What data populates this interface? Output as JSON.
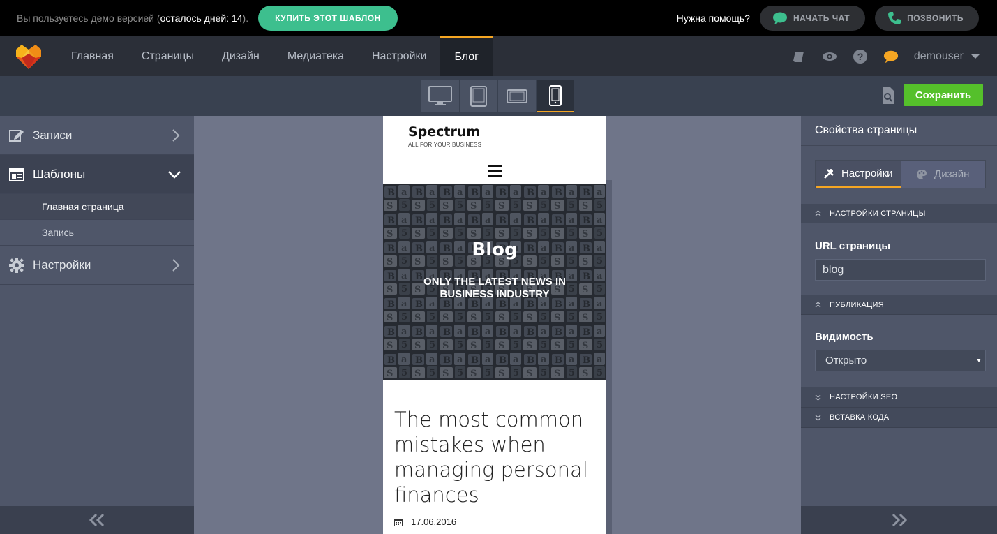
{
  "topbar": {
    "demo_prefix": "Вы пользуетесь демо версией (",
    "demo_days": "осталось дней: 14",
    "demo_suffix": ").",
    "buy_label": "КУПИТЬ ЭТОТ ШАБЛОН",
    "help_label": "Нужна помощь?",
    "chat_label": "НАЧАТЬ ЧАТ",
    "call_label": "ПОЗВОНИТЬ"
  },
  "nav": {
    "items": [
      {
        "label": "Главная"
      },
      {
        "label": "Страницы"
      },
      {
        "label": "Дизайн"
      },
      {
        "label": "Медиатека"
      },
      {
        "label": "Настройки"
      },
      {
        "label": "Блог"
      }
    ],
    "active": "Блог",
    "user": "demouser"
  },
  "toolbar": {
    "save_label": "Сохранить",
    "devices": [
      "desktop",
      "tablet",
      "tablet-landscape",
      "phone"
    ],
    "active_device": "phone"
  },
  "left_panel": {
    "items": [
      {
        "label": "Записи",
        "icon": "edit-icon"
      },
      {
        "label": "Шаблоны",
        "icon": "template-icon"
      },
      {
        "label": "Настройки",
        "icon": "gear-icon"
      }
    ],
    "sub_items": [
      {
        "label": "Главная страница"
      },
      {
        "label": "Запись"
      }
    ]
  },
  "right_panel": {
    "title": "Свойства страницы",
    "tab_settings": "Настройки",
    "tab_design": "Дизайн",
    "sec_page": "НАСТРОЙКИ СТРАНИЦЫ",
    "url_label": "URL страницы",
    "url_value": "blog",
    "sec_pub": "ПУБЛИКАЦИЯ",
    "visibility_label": "Видимость",
    "visibility_value": "Открыто",
    "sec_seo": "НАСТРОЙКИ SEO",
    "sec_code": "ВСТАВКА КОДА"
  },
  "preview": {
    "brand": "Spectrum",
    "tagline": "ALL FOR YOUR BUSINESS",
    "hero_title": "Blog",
    "hero_subtitle": "ONLY THE LATEST NEWS IN BUSINESS INDUSTRY",
    "post_title": "The most common mistakes when managing personal finances",
    "post_date": "17.06.2016"
  },
  "colors": {
    "accent": "#f5a623",
    "green": "#3dbf8e",
    "save": "#55c02b"
  }
}
